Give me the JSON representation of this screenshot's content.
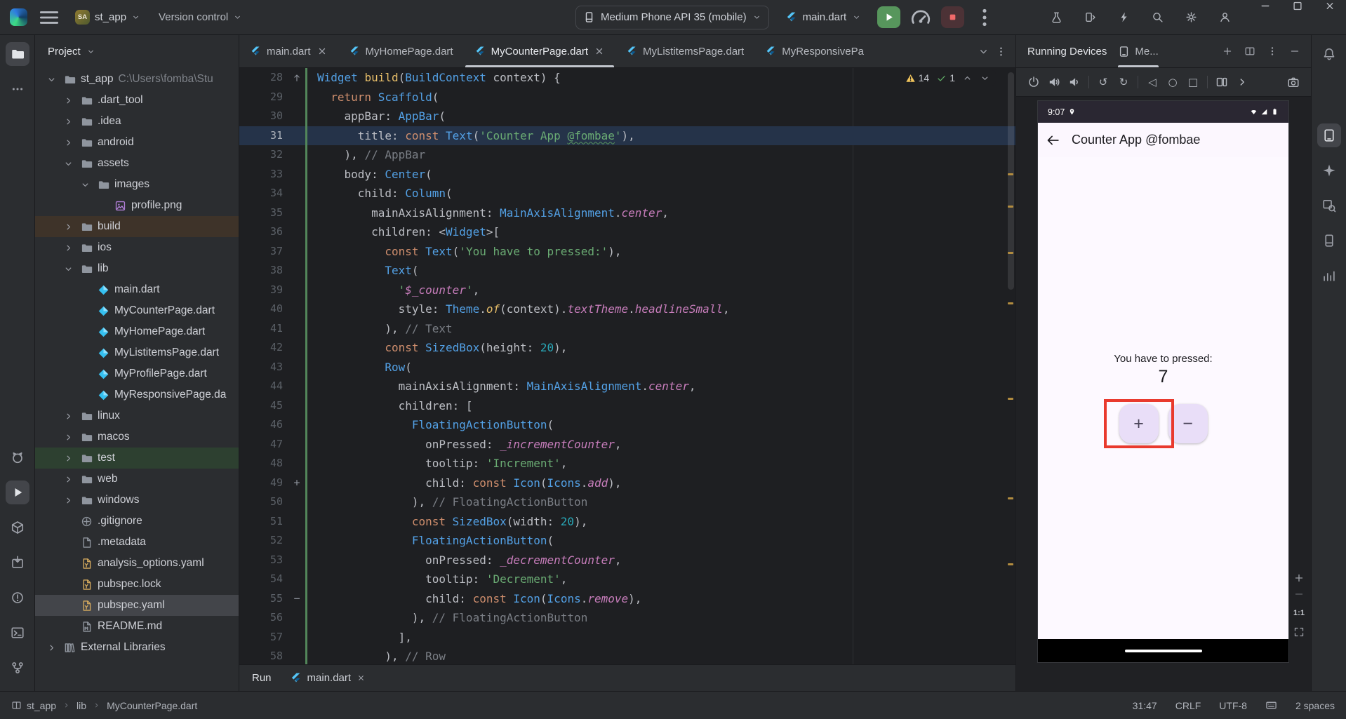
{
  "titlebar": {
    "project_name": "st_app",
    "project_avatar": "SA",
    "vcs_label": "Version control",
    "device_selector": "Medium Phone API 35 (mobile)",
    "run_config": "main.dart",
    "right_icons": [
      {
        "n": "beaker-icon",
        "i": "beaker"
      },
      {
        "n": "device-mirror-icon",
        "i": "mirror"
      },
      {
        "n": "lightning-icon",
        "i": "bolt"
      },
      {
        "n": "search-icon",
        "i": "search"
      },
      {
        "n": "settings-icon",
        "i": "gear"
      },
      {
        "n": "profile-icon",
        "i": "avatar"
      }
    ]
  },
  "left_strip": {
    "top": [
      {
        "n": "project-tool-button",
        "i": "folder",
        "active": true
      },
      {
        "n": "more-tools-button",
        "i": "moreH"
      }
    ],
    "bottom": [
      {
        "n": "logcat-button",
        "i": "logcat"
      },
      {
        "n": "run-tool-button",
        "i": "runplay",
        "active": true
      },
      {
        "n": "build-tool-button",
        "i": "buildbox"
      },
      {
        "n": "app-inspection-button",
        "i": "inspect"
      },
      {
        "n": "problems-button",
        "i": "problems"
      },
      {
        "n": "terminal-button",
        "i": "term"
      },
      {
        "n": "version-control-button",
        "i": "git"
      }
    ]
  },
  "right_strip": {
    "top": [
      {
        "n": "notifications-button",
        "i": "bell"
      }
    ],
    "group": [
      {
        "n": "running-devices-button",
        "i": "rundev",
        "active": true
      },
      {
        "n": "gemini-button",
        "i": "gemini"
      },
      {
        "n": "layout-inspector-button",
        "i": "layout"
      },
      {
        "n": "device-explorer-button",
        "i": "devexp"
      },
      {
        "n": "app-insights-button",
        "i": "insights"
      }
    ]
  },
  "project_panel": {
    "title": "Project",
    "tree": [
      {
        "lvl": 0,
        "chev": "open",
        "icon": "folder",
        "label": "st_app",
        "sub": "C:\\Users\\fomba\\Stu"
      },
      {
        "lvl": 1,
        "chev": "closed",
        "icon": "folder",
        "label": ".dart_tool"
      },
      {
        "lvl": 1,
        "chev": "closed",
        "icon": "folder",
        "label": ".idea"
      },
      {
        "lvl": 1,
        "chev": "closed",
        "icon": "folder",
        "label": "android"
      },
      {
        "lvl": 1,
        "chev": "open",
        "icon": "folder",
        "label": "assets"
      },
      {
        "lvl": 2,
        "chev": "open",
        "icon": "folder",
        "label": "images"
      },
      {
        "lvl": 3,
        "chev": "none",
        "icon": "imgfile",
        "label": "profile.png"
      },
      {
        "lvl": 1,
        "chev": "closed",
        "icon": "folder",
        "label": "build",
        "row": "build"
      },
      {
        "lvl": 1,
        "chev": "closed",
        "icon": "folder",
        "label": "ios"
      },
      {
        "lvl": 1,
        "chev": "open",
        "icon": "folder",
        "label": "lib"
      },
      {
        "lvl": 2,
        "chev": "none",
        "icon": "dart",
        "label": "main.dart"
      },
      {
        "lvl": 2,
        "chev": "none",
        "icon": "dart",
        "label": "MyCounterPage.dart"
      },
      {
        "lvl": 2,
        "chev": "none",
        "icon": "dart",
        "label": "MyHomePage.dart"
      },
      {
        "lvl": 2,
        "chev": "none",
        "icon": "dart",
        "label": "MyListitemsPage.dart"
      },
      {
        "lvl": 2,
        "chev": "none",
        "icon": "dart",
        "label": "MyProfilePage.dart"
      },
      {
        "lvl": 2,
        "chev": "none",
        "icon": "dart",
        "label": "MyResponsivePage.da"
      },
      {
        "lvl": 1,
        "chev": "closed",
        "icon": "folder",
        "label": "linux"
      },
      {
        "lvl": 1,
        "chev": "closed",
        "icon": "folder",
        "label": "macos"
      },
      {
        "lvl": 1,
        "chev": "closed",
        "icon": "folder",
        "label": "test",
        "row": "test"
      },
      {
        "lvl": 1,
        "chev": "closed",
        "icon": "folder",
        "label": "web"
      },
      {
        "lvl": 1,
        "chev": "closed",
        "icon": "folder",
        "label": "windows"
      },
      {
        "lvl": 1,
        "chev": "none",
        "icon": "gitfile",
        "label": ".gitignore"
      },
      {
        "lvl": 1,
        "chev": "none",
        "icon": "doc",
        "label": ".metadata"
      },
      {
        "lvl": 1,
        "chev": "none",
        "icon": "yaml",
        "label": "analysis_options.yaml"
      },
      {
        "lvl": 1,
        "chev": "none",
        "icon": "yaml",
        "label": "pubspec.lock"
      },
      {
        "lvl": 1,
        "chev": "none",
        "icon": "yaml",
        "label": "pubspec.yaml",
        "row": "selected"
      },
      {
        "lvl": 1,
        "chev": "none",
        "icon": "md",
        "label": "README.md"
      },
      {
        "lvl": 0,
        "chev": "closed",
        "icon": "lib",
        "label": "External Libraries"
      }
    ]
  },
  "editor": {
    "tabs": [
      {
        "label": "main.dart",
        "close": true
      },
      {
        "label": "MyHomePage.dart",
        "close": false
      },
      {
        "label": "MyCounterPage.dart",
        "close": true,
        "active": true
      },
      {
        "label": "MyListitemsPage.dart",
        "close": false
      },
      {
        "label": "MyResponsivePa",
        "close": false
      }
    ],
    "inspections": {
      "warnings": "14",
      "passed": "1"
    },
    "lines": [
      {
        "n": 28,
        "g": "override",
        "t": [
          [
            "c",
            "Widget"
          ],
          [
            "p",
            " "
          ],
          [
            "f",
            "build"
          ],
          [
            "p",
            "("
          ],
          [
            "c",
            "BuildContext"
          ],
          [
            "p",
            " context) {"
          ]
        ]
      },
      {
        "n": 29,
        "t": [
          [
            "p",
            "  "
          ],
          [
            "k",
            "return"
          ],
          [
            "p",
            " "
          ],
          [
            "c",
            "Scaffold"
          ],
          [
            "p",
            "("
          ]
        ]
      },
      {
        "n": 30,
        "t": [
          [
            "p",
            "    appBar: "
          ],
          [
            "c",
            "AppBar"
          ],
          [
            "p",
            "("
          ]
        ]
      },
      {
        "n": 31,
        "cur": true,
        "t": [
          [
            "p",
            "      title: "
          ],
          [
            "k",
            "const"
          ],
          [
            "p",
            " "
          ],
          [
            "c",
            "Text"
          ],
          [
            "p",
            "("
          ],
          [
            "s",
            "'Counter App "
          ],
          [
            "sw",
            "@fombae"
          ],
          [
            "s",
            "'"
          ],
          [
            "p",
            "),"
          ]
        ]
      },
      {
        "n": 32,
        "t": [
          [
            "p",
            "    ), "
          ],
          [
            "cm",
            "// AppBar"
          ]
        ]
      },
      {
        "n": 33,
        "t": [
          [
            "p",
            "    body: "
          ],
          [
            "c",
            "Center"
          ],
          [
            "p",
            "("
          ]
        ]
      },
      {
        "n": 34,
        "t": [
          [
            "p",
            "      child: "
          ],
          [
            "c",
            "Column"
          ],
          [
            "p",
            "("
          ]
        ]
      },
      {
        "n": 35,
        "t": [
          [
            "p",
            "        mainAxisAlignment: "
          ],
          [
            "c",
            "MainAxisAlignment"
          ],
          [
            "p",
            "."
          ],
          [
            "m",
            "center"
          ],
          [
            "p",
            ","
          ]
        ]
      },
      {
        "n": 36,
        "t": [
          [
            "p",
            "        children: <"
          ],
          [
            "c",
            "Widget"
          ],
          [
            "p",
            ">["
          ]
        ]
      },
      {
        "n": 37,
        "t": [
          [
            "p",
            "          "
          ],
          [
            "k",
            "const"
          ],
          [
            "p",
            " "
          ],
          [
            "c",
            "Text"
          ],
          [
            "p",
            "("
          ],
          [
            "s",
            "'You have to pressed:'"
          ],
          [
            "p",
            "),"
          ]
        ]
      },
      {
        "n": 38,
        "t": [
          [
            "p",
            "          "
          ],
          [
            "c",
            "Text"
          ],
          [
            "p",
            "("
          ]
        ]
      },
      {
        "n": 39,
        "t": [
          [
            "p",
            "            "
          ],
          [
            "s",
            "'"
          ],
          [
            "m",
            "$_counter"
          ],
          [
            "s",
            "'"
          ],
          [
            "p",
            ","
          ]
        ]
      },
      {
        "n": 40,
        "t": [
          [
            "p",
            "            style: "
          ],
          [
            "c",
            "Theme"
          ],
          [
            "p",
            "."
          ],
          [
            "fi",
            "of"
          ],
          [
            "p",
            "(context)."
          ],
          [
            "m",
            "textTheme"
          ],
          [
            "p",
            "."
          ],
          [
            "m",
            "headlineSmall"
          ],
          [
            "p",
            ","
          ]
        ]
      },
      {
        "n": 41,
        "t": [
          [
            "p",
            "          ), "
          ],
          [
            "cm",
            "// Text"
          ]
        ]
      },
      {
        "n": 42,
        "t": [
          [
            "p",
            "          "
          ],
          [
            "k",
            "const"
          ],
          [
            "p",
            " "
          ],
          [
            "c",
            "SizedBox"
          ],
          [
            "p",
            "(height: "
          ],
          [
            "n",
            "20"
          ],
          [
            "p",
            "),"
          ]
        ]
      },
      {
        "n": 43,
        "t": [
          [
            "p",
            "          "
          ],
          [
            "c",
            "Row"
          ],
          [
            "p",
            "("
          ]
        ]
      },
      {
        "n": 44,
        "t": [
          [
            "p",
            "            mainAxisAlignment: "
          ],
          [
            "c",
            "MainAxisAlignment"
          ],
          [
            "p",
            "."
          ],
          [
            "m",
            "center"
          ],
          [
            "p",
            ","
          ]
        ]
      },
      {
        "n": 45,
        "t": [
          [
            "p",
            "            children: ["
          ]
        ]
      },
      {
        "n": 46,
        "t": [
          [
            "p",
            "              "
          ],
          [
            "c",
            "FloatingActionButton"
          ],
          [
            "p",
            "("
          ]
        ]
      },
      {
        "n": 47,
        "t": [
          [
            "p",
            "                onPressed: "
          ],
          [
            "m",
            "_incrementCounter"
          ],
          [
            "p",
            ","
          ]
        ]
      },
      {
        "n": 48,
        "t": [
          [
            "p",
            "                tooltip: "
          ],
          [
            "s",
            "'Increment'"
          ],
          [
            "p",
            ","
          ]
        ]
      },
      {
        "n": 49,
        "g": "plus",
        "t": [
          [
            "p",
            "                child: "
          ],
          [
            "k",
            "const"
          ],
          [
            "p",
            " "
          ],
          [
            "c",
            "Icon"
          ],
          [
            "p",
            "("
          ],
          [
            "c",
            "Icons"
          ],
          [
            "p",
            "."
          ],
          [
            "m",
            "add"
          ],
          [
            "p",
            "),"
          ]
        ]
      },
      {
        "n": 50,
        "t": [
          [
            "p",
            "              ), "
          ],
          [
            "cm",
            "// FloatingActionButton"
          ]
        ]
      },
      {
        "n": 51,
        "t": [
          [
            "p",
            "              "
          ],
          [
            "k",
            "const"
          ],
          [
            "p",
            " "
          ],
          [
            "c",
            "SizedBox"
          ],
          [
            "p",
            "(width: "
          ],
          [
            "n",
            "20"
          ],
          [
            "p",
            "),"
          ]
        ]
      },
      {
        "n": 52,
        "t": [
          [
            "p",
            "              "
          ],
          [
            "c",
            "FloatingActionButton"
          ],
          [
            "p",
            "("
          ]
        ]
      },
      {
        "n": 53,
        "t": [
          [
            "p",
            "                onPressed: "
          ],
          [
            "m",
            "_decrementCounter"
          ],
          [
            "p",
            ","
          ]
        ]
      },
      {
        "n": 54,
        "t": [
          [
            "p",
            "                tooltip: "
          ],
          [
            "s",
            "'Decrement'"
          ],
          [
            "p",
            ","
          ]
        ]
      },
      {
        "n": 55,
        "g": "minus",
        "t": [
          [
            "p",
            "                child: "
          ],
          [
            "k",
            "const"
          ],
          [
            "p",
            " "
          ],
          [
            "c",
            "Icon"
          ],
          [
            "p",
            "("
          ],
          [
            "c",
            "Icons"
          ],
          [
            "p",
            "."
          ],
          [
            "m",
            "remove"
          ],
          [
            "p",
            "),"
          ]
        ]
      },
      {
        "n": 56,
        "t": [
          [
            "p",
            "              ), "
          ],
          [
            "cm",
            "// FloatingActionButton"
          ]
        ]
      },
      {
        "n": 57,
        "t": [
          [
            "p",
            "            ],"
          ]
        ]
      },
      {
        "n": 58,
        "t": [
          [
            "p",
            "          ), "
          ],
          [
            "cm",
            "// Row"
          ]
        ]
      }
    ]
  },
  "devices_panel": {
    "title": "Running Devices",
    "device_tab": "Me...",
    "toolbar": [
      {
        "n": "power-button",
        "i": "power"
      },
      {
        "n": "volume-up-button",
        "i": "volU"
      },
      {
        "n": "volume-down-button",
        "i": "volD"
      },
      {
        "n": "sep"
      },
      {
        "n": "rotate-left-button",
        "i": "rotL"
      },
      {
        "n": "rotate-right-button",
        "i": "rotR"
      },
      {
        "n": "sep"
      },
      {
        "n": "back-button",
        "i": "back"
      },
      {
        "n": "home-button",
        "i": "home"
      },
      {
        "n": "overview-button",
        "i": "over"
      },
      {
        "n": "sep"
      },
      {
        "n": "fold-button",
        "i": "fold"
      },
      {
        "n": "expand-toolbar-button",
        "i": "chevR"
      }
    ],
    "screenshot_button": {
      "n": "screenshot-button",
      "i": "cam"
    },
    "phone": {
      "status_time": "9:07",
      "app_title": "Counter App @fombae",
      "label": "You have to pressed:",
      "counter_value": "7",
      "fab_increment": "+",
      "fab_decrement": "−"
    },
    "zoom_reset": "1:1"
  },
  "run_bar": {
    "label": "Run",
    "tab_label": "main.dart"
  },
  "status_bar": {
    "crumbs": [
      "st_app",
      "lib",
      "MyCounterPage.dart"
    ],
    "caret": "31:47",
    "line_sep": "CRLF",
    "encoding": "UTF-8",
    "indent": "2 spaces"
  }
}
